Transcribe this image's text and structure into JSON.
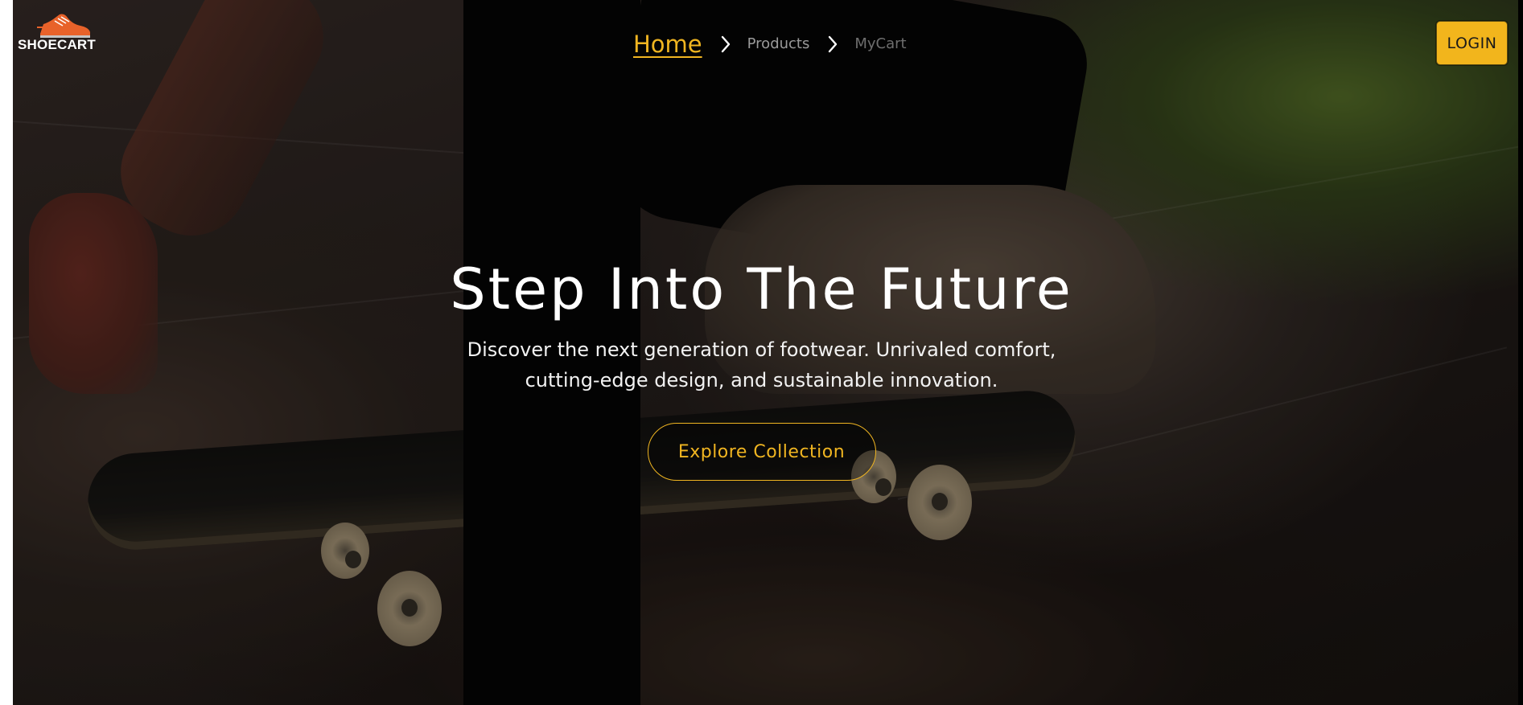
{
  "brand": {
    "name": "SHOECART",
    "logo_icon": "sneaker-icon",
    "logo_color": "#e8622a"
  },
  "breadcrumb": {
    "items": [
      {
        "label": "Home",
        "state": "active"
      },
      {
        "label": "Products",
        "state": "link"
      },
      {
        "label": "MyCart",
        "state": "current"
      }
    ],
    "separator_icon": "chevron-right-icon"
  },
  "header": {
    "login_label": "LOGIN"
  },
  "hero": {
    "headline": "Step Into The Future",
    "subtext": "Discover the next generation of footwear. Unrivaled comfort, cutting-edge design, and sustainable innovation.",
    "cta_label": "Explore Collection",
    "background_scene": "skateboarder-photo"
  },
  "colors": {
    "accent": "#f0b521",
    "text_primary": "#ffffff",
    "breadcrumb_muted": "#9a9a9a"
  }
}
